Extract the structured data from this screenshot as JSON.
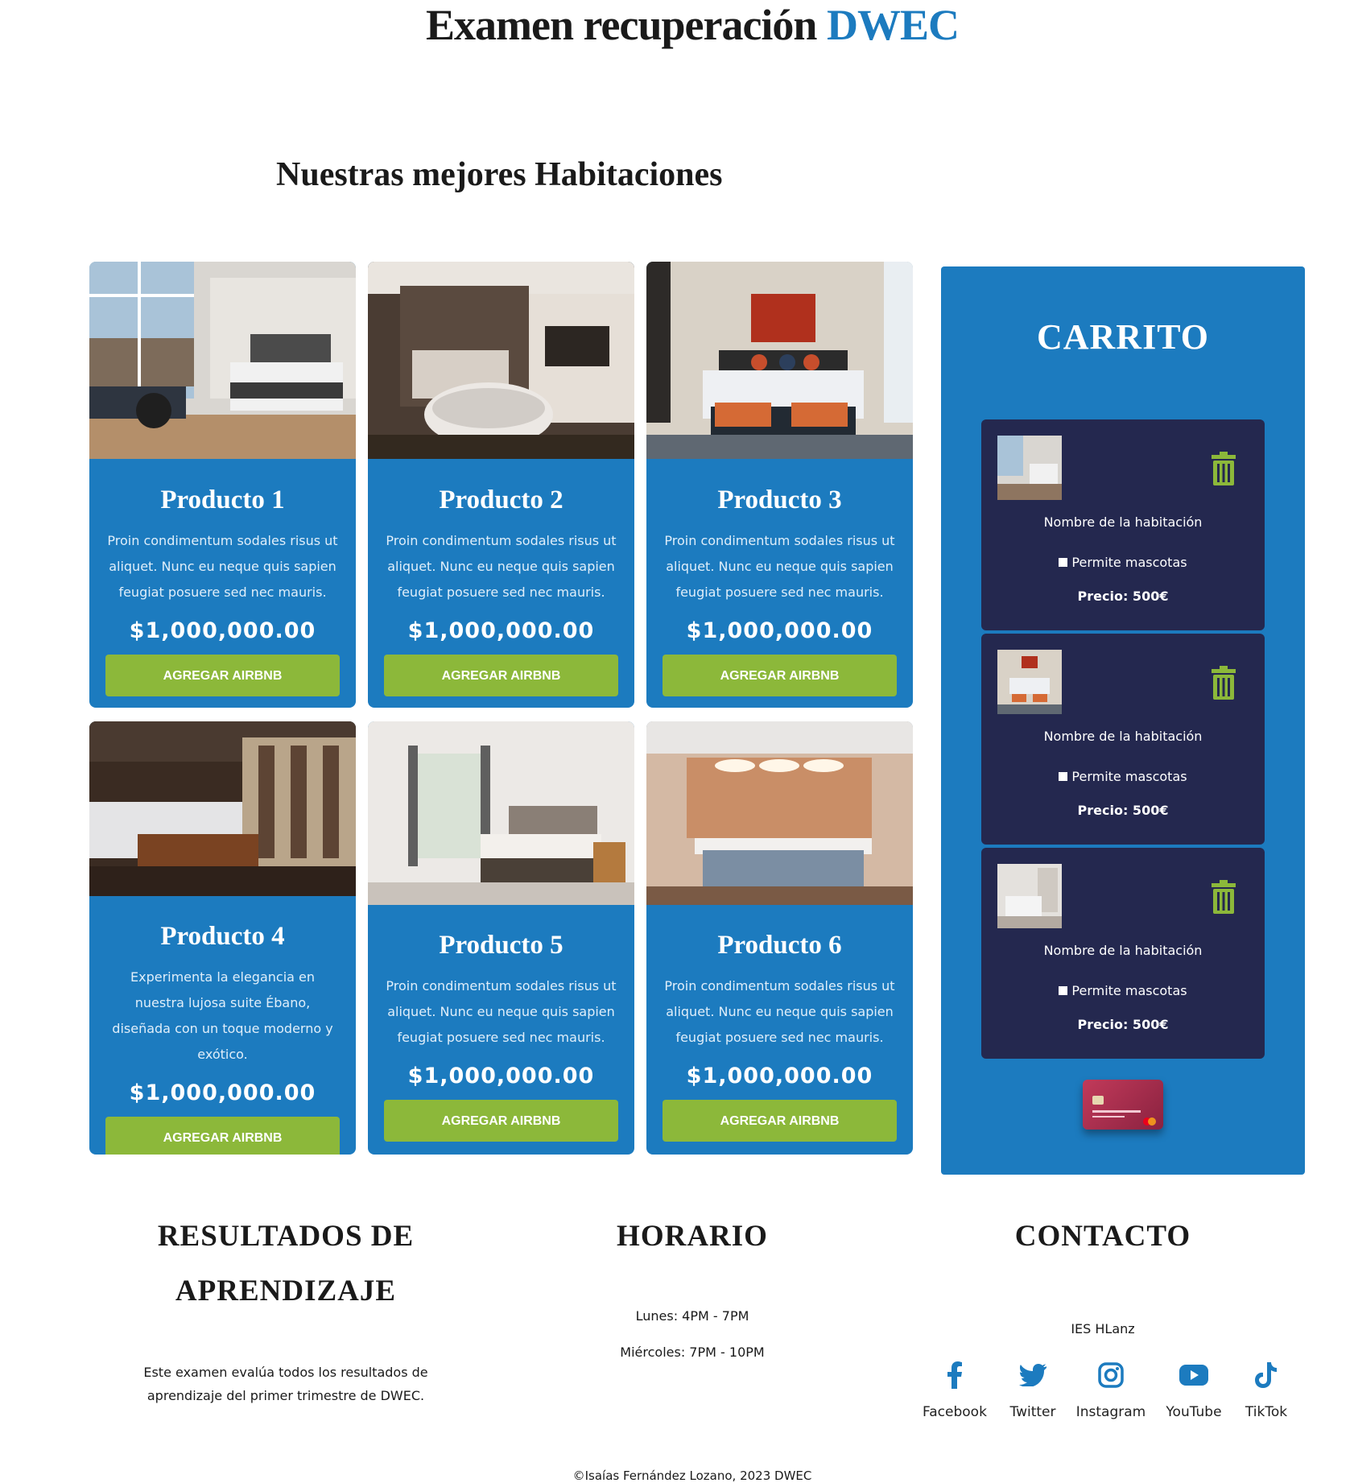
{
  "header": {
    "title_main": "Examen recuperación",
    "title_accent": "DWEC",
    "accent_color": "#1c7bbf"
  },
  "section_title": "Nuestras mejores Habitaciones",
  "products": [
    {
      "title": "Producto 1",
      "desc": "Proin condimentum sodales risus ut aliquet. Nunc eu neque quis sapien feugiat posuere sed nec mauris.",
      "price": "$1,000,000.00",
      "button": "AGREGAR AIRBNB"
    },
    {
      "title": "Producto 2",
      "desc": "Proin condimentum sodales risus ut aliquet. Nunc eu neque quis sapien feugiat posuere sed nec mauris.",
      "price": "$1,000,000.00",
      "button": "AGREGAR AIRBNB"
    },
    {
      "title": "Producto 3",
      "desc": "Proin condimentum sodales risus ut aliquet. Nunc eu neque quis sapien feugiat posuere sed nec mauris.",
      "price": "$1,000,000.00",
      "button": "AGREGAR AIRBNB"
    },
    {
      "title": "Producto 4",
      "desc": "Experimenta la elegancia en nuestra lujosa suite Ébano, diseñada con un toque moderno y exótico.",
      "price": "$1,000,000.00",
      "button": "AGREGAR AIRBNB"
    },
    {
      "title": "Producto 5",
      "desc": "Proin condimentum sodales risus ut aliquet. Nunc eu neque quis sapien feugiat posuere sed nec mauris.",
      "price": "$1,000,000.00",
      "button": "AGREGAR AIRBNB"
    },
    {
      "title": "Producto 6",
      "desc": "Proin condimentum sodales risus ut aliquet. Nunc eu neque quis sapien feugiat posuere sed nec mauris.",
      "price": "$1,000,000.00",
      "button": "AGREGAR AIRBNB"
    }
  ],
  "cart": {
    "title": "CARRITO",
    "items": [
      {
        "name": "Nombre de la habitación",
        "pets": "Permite mascotas",
        "price": "Precio: 500€"
      },
      {
        "name": "Nombre de la habitación",
        "pets": "Permite mascotas",
        "price": "Precio: 500€"
      },
      {
        "name": "Nombre de la habitación",
        "pets": "Permite mascotas",
        "price": "Precio: 500€"
      }
    ]
  },
  "footer": {
    "results": {
      "title_line1": "RESULTADOS DE",
      "title_line2": "APRENDIZAJE",
      "text": "Este examen evalúa todos los resultados de aprendizaje del primer trimestre de DWEC."
    },
    "schedule": {
      "title": "HORARIO",
      "line1": "Lunes: 4PM - 7PM",
      "line2": "Miércoles: 7PM - 10PM"
    },
    "contact": {
      "title": "CONTACTO",
      "org": "IES HLanz",
      "social": [
        "Facebook",
        "Twitter",
        "Instagram",
        "YouTube",
        "TikTok"
      ]
    },
    "copyright": "©Isaías Fernández Lozano, 2023 DWEC"
  },
  "colors": {
    "card_blue": "#1c7bbf",
    "button_green": "#8cb83a",
    "cart_item_navy": "#24284f"
  },
  "icons": [
    "trash-icon",
    "facebook-icon",
    "twitter-icon",
    "instagram-icon",
    "youtube-icon",
    "tiktok-icon",
    "payment-card-icon"
  ]
}
